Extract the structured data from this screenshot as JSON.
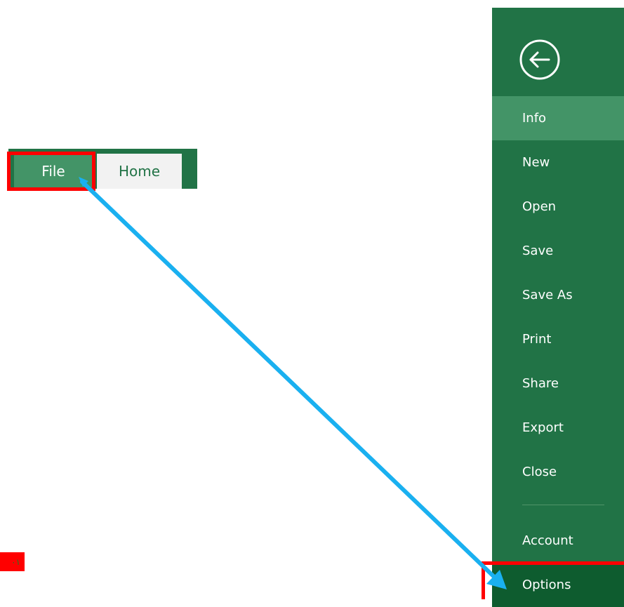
{
  "ribbon": {
    "tabs": [
      {
        "label": "File"
      },
      {
        "label": "Home"
      }
    ]
  },
  "backstage": {
    "back_icon": "back-arrow-circle-icon",
    "items": [
      {
        "label": "Info"
      },
      {
        "label": "New"
      },
      {
        "label": "Open"
      },
      {
        "label": "Save"
      },
      {
        "label": "Save As"
      },
      {
        "label": "Print"
      },
      {
        "label": "Share"
      },
      {
        "label": "Export"
      },
      {
        "label": "Close"
      },
      {
        "label": "Account"
      },
      {
        "label": "Options"
      }
    ]
  },
  "annotation": {
    "tag_text": "۰۱"
  },
  "colors": {
    "excel_green": "#217346",
    "active_item": "#439467",
    "selected_item": "#0e5c2f",
    "highlight": "#ff0000",
    "arrow": "#1ab0f0"
  }
}
